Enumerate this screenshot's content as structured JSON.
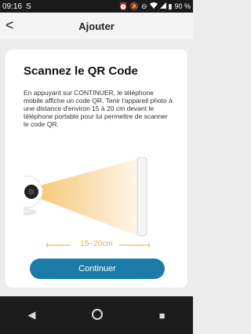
{
  "status_bar": {
    "time": "09:16",
    "carrier_glyph": "S",
    "battery": "90 %",
    "icons": [
      "alarm-icon",
      "mute-icon",
      "dnd-icon",
      "wifi-icon",
      "signal-icon",
      "battery-icon"
    ]
  },
  "header": {
    "title": "Ajouter",
    "back_icon": "back-arrow-icon"
  },
  "card": {
    "heading": "Scannez le QR Code",
    "description": "En appuyant sur CONTINUER, le téléphone mobile affiche un code QR. Tenir l'appareil photo à une distance d'environ 15 à 20 cm devant le téléphone portable pour lui permettre de scanner le code QR.",
    "distance_label": "15~20cm",
    "button_label": "Continuer"
  },
  "colors": {
    "accent": "#1a7ba8",
    "beam": "#f6c26b",
    "distance": "#f2a93b"
  },
  "nav": {
    "back_icon": "nav-back-icon",
    "home_icon": "nav-home-icon",
    "recents_icon": "nav-recents-icon"
  }
}
